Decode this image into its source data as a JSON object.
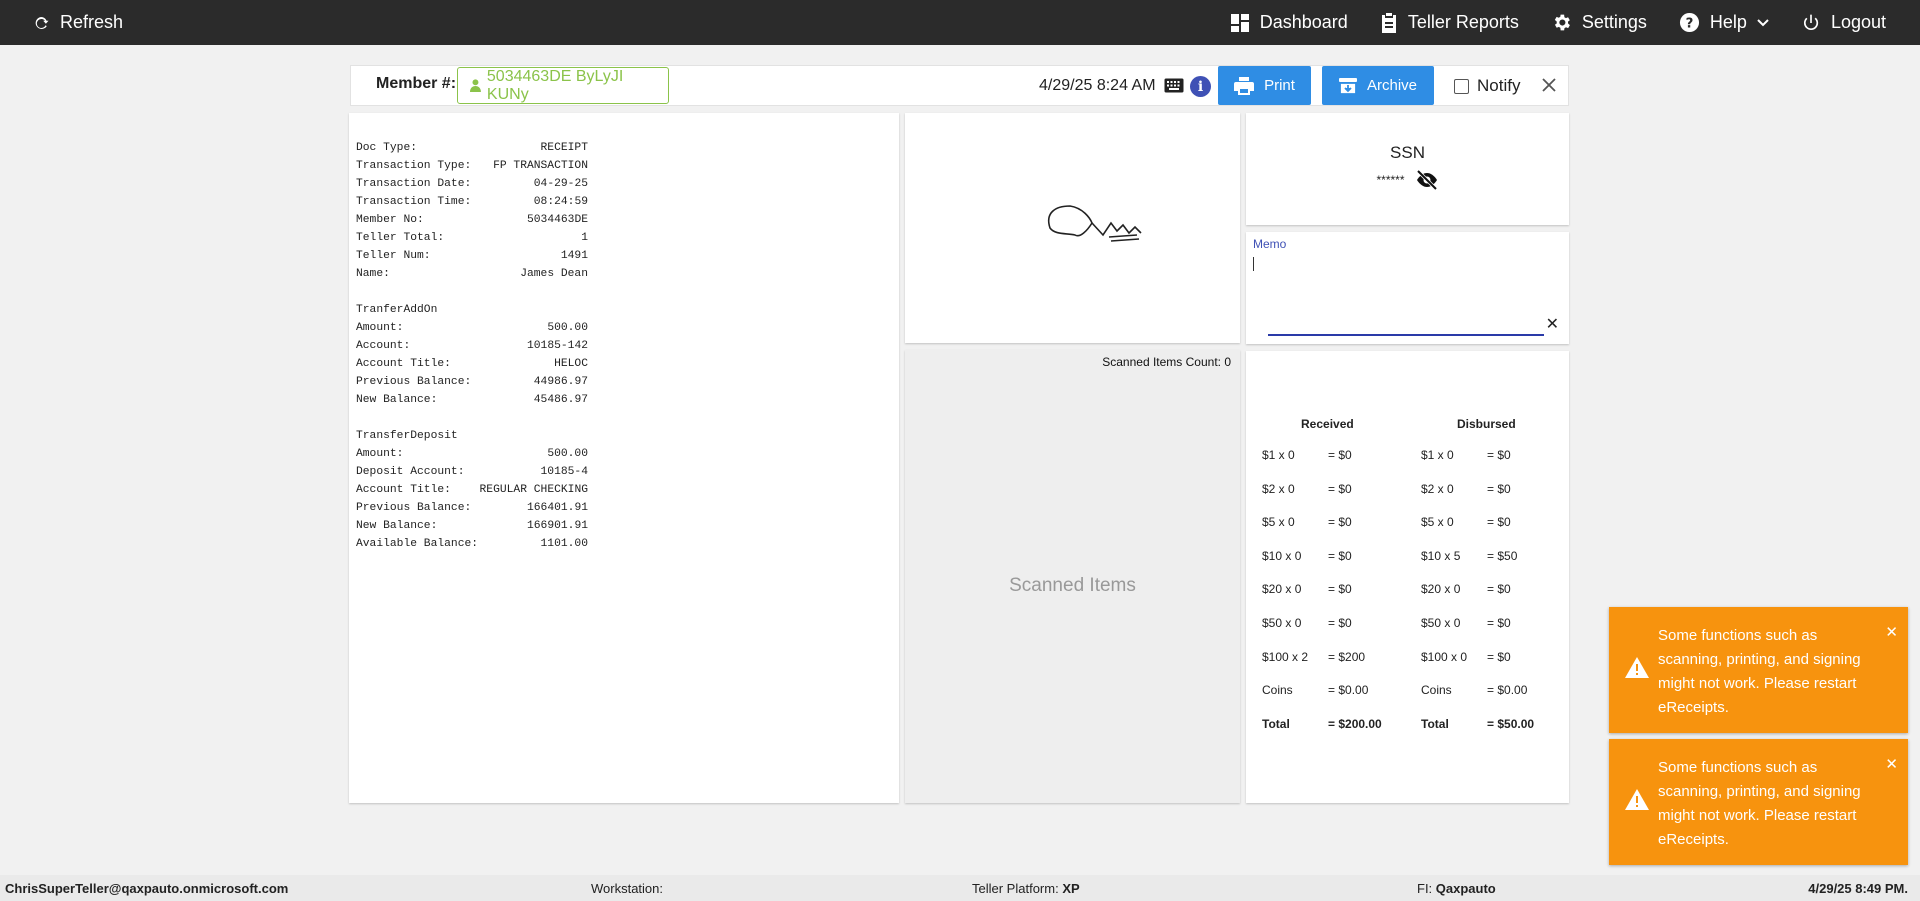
{
  "topbar": {
    "refresh_label": "Refresh",
    "nav": [
      {
        "label": "Dashboard",
        "icon": "dashboard-icon"
      },
      {
        "label": "Teller Reports",
        "icon": "clipboard-icon"
      },
      {
        "label": "Settings",
        "icon": "gear-icon"
      },
      {
        "label": "Help",
        "icon": "help-icon"
      },
      {
        "label": "Logout",
        "icon": "power-icon"
      }
    ]
  },
  "member": {
    "label": "Member #:",
    "value": "5034463DE ByLyJI KUNy",
    "date": "4/29/25 8:24 AM",
    "print_label": "Print",
    "archive_label": "Archive",
    "notify_label": "Notify"
  },
  "receipt": {
    "lines": [
      [
        "Doc Type:",
        "RECEIPT"
      ],
      [
        "Transaction Type:",
        "FP TRANSACTION"
      ],
      [
        "Transaction Date:",
        "04-29-25"
      ],
      [
        "Transaction Time:",
        "08:24:59"
      ],
      [
        "Member No:",
        "5034463DE"
      ],
      [
        "Teller Total:",
        "1"
      ],
      [
        "Teller Num:",
        "1491"
      ],
      [
        "Name:",
        "James Dean"
      ],
      [
        "",
        ""
      ],
      [
        "TranferAddOn",
        ""
      ],
      [
        "Amount:",
        "500.00"
      ],
      [
        "Account:",
        "10185-142"
      ],
      [
        "Account Title:",
        "HELOC"
      ],
      [
        "Previous Balance:",
        "44986.97"
      ],
      [
        "New Balance:",
        "45486.97"
      ],
      [
        "",
        ""
      ],
      [
        "TransferDeposit",
        ""
      ],
      [
        "Amount:",
        "500.00"
      ],
      [
        "Deposit Account:",
        "10185-4"
      ],
      [
        "Account Title:",
        "REGULAR CHECKING"
      ],
      [
        "Previous Balance:",
        "166401.91"
      ],
      [
        "New Balance:",
        "166901.91"
      ],
      [
        "Available Balance:",
        "1101.00"
      ]
    ]
  },
  "scanned": {
    "count_label": "Scanned Items Count: 0",
    "title": "Scanned Items"
  },
  "ssn": {
    "title": "SSN",
    "masked": "******"
  },
  "memo": {
    "label": "Memo"
  },
  "cash": {
    "received_label": "Received",
    "disbursed_label": "Disbursed",
    "rows": [
      {
        "r_denom": "$1 x 0",
        "r_amt": "= $0",
        "d_denom": "$1 x 0",
        "d_amt": "= $0"
      },
      {
        "r_denom": "$2 x 0",
        "r_amt": "= $0",
        "d_denom": "$2 x 0",
        "d_amt": "= $0"
      },
      {
        "r_denom": "$5 x 0",
        "r_amt": "= $0",
        "d_denom": "$5 x 0",
        "d_amt": "= $0"
      },
      {
        "r_denom": "$10 x 0",
        "r_amt": "= $0",
        "d_denom": "$10 x 5",
        "d_amt": "= $50"
      },
      {
        "r_denom": "$20 x 0",
        "r_amt": "= $0",
        "d_denom": "$20 x 0",
        "d_amt": "= $0"
      },
      {
        "r_denom": "$50 x 0",
        "r_amt": "= $0",
        "d_denom": "$50 x 0",
        "d_amt": "= $0"
      },
      {
        "r_denom": "$100 x 2",
        "r_amt": "= $200",
        "d_denom": "$100 x 0",
        "d_amt": "= $0"
      },
      {
        "r_denom": "Coins",
        "r_amt": "= $0.00",
        "d_denom": "Coins",
        "d_amt": "= $0.00"
      },
      {
        "r_denom": "Total",
        "r_amt": "= $200.00",
        "d_denom": "Total",
        "d_amt": "= $50.00"
      }
    ]
  },
  "toasts": [
    {
      "text": "Some functions such as scanning, printing, and signing might not work. Please restart eReceipts."
    },
    {
      "text": "Some functions such as scanning, printing, and signing might not work. Please restart eReceipts."
    }
  ],
  "status": {
    "user": "ChrisSuperTeller@qaxpauto.onmicrosoft.com",
    "workstation_label": "Workstation:",
    "platform_label": "Teller Platform:",
    "platform_value": "XP",
    "fi_label": "FI:",
    "fi_value": "Qaxpauto",
    "datetime": "4/29/25 8:49 PM."
  },
  "colors": {
    "topbar": "#2b2b2b",
    "accent_blue": "#2f8de4",
    "member_green": "#8bc34a",
    "toast_orange": "#f7930e",
    "memo_blue": "#3f51b5"
  }
}
